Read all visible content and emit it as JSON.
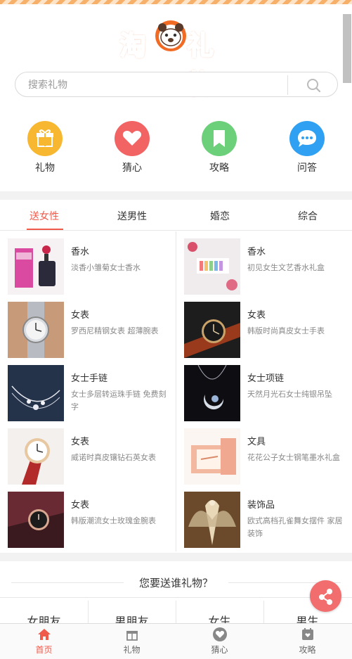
{
  "header": {
    "logo_left": "淘",
    "logo_right": "礼物"
  },
  "search": {
    "placeholder": "搜索礼物"
  },
  "categories": [
    {
      "label": "礼物",
      "icon": "gift-icon",
      "color": "#f7b731"
    },
    {
      "label": "猜心",
      "icon": "heart-icon",
      "color": "#f26363"
    },
    {
      "label": "攻略",
      "icon": "bookmark-icon",
      "color": "#6ccf7a"
    },
    {
      "label": "问答",
      "icon": "chat-bubble-icon",
      "color": "#2fa0f2"
    }
  ],
  "tabs": [
    {
      "label": "送女性",
      "active": true
    },
    {
      "label": "送男性",
      "active": false
    },
    {
      "label": "婚恋",
      "active": false
    },
    {
      "label": "综合",
      "active": false
    }
  ],
  "products": [
    {
      "title": "香水",
      "desc": "淡香小雏菊女士香水"
    },
    {
      "title": "香水",
      "desc": "初见女生文艺香水礼盒"
    },
    {
      "title": "女表",
      "desc": "罗西尼精钢女表 超薄腕表"
    },
    {
      "title": "女表",
      "desc": "韩版时尚真皮女士手表"
    },
    {
      "title": "女士手链",
      "desc": "女士多层转运珠手链 免费刻字"
    },
    {
      "title": "女士项链",
      "desc": "天然月光石女士纯银吊坠"
    },
    {
      "title": "女表",
      "desc": "威诺时真皮镶钻石英女表"
    },
    {
      "title": "文具",
      "desc": "花花公子女士钢笔墨水礼盒"
    },
    {
      "title": "女表",
      "desc": "韩版潮流女士玫瑰金腕表"
    },
    {
      "title": "装饰品",
      "desc": "欧式高档孔雀舞女摆件 家居装饰"
    }
  ],
  "ask": {
    "title": "您要送谁礼物？"
  },
  "recipients": [
    "女朋友",
    "男朋友",
    "女生",
    "男生"
  ],
  "bottom_nav": [
    {
      "label": "首页",
      "icon": "home-icon",
      "active": true
    },
    {
      "label": "礼物",
      "icon": "gift-icon",
      "active": false
    },
    {
      "label": "猜心",
      "icon": "heart-icon",
      "active": false
    },
    {
      "label": "攻略",
      "icon": "calendar-icon",
      "active": false
    }
  ],
  "colors": {
    "accent": "#f05a4a",
    "share_button": "#f26d6d",
    "logo": "#f26b24"
  }
}
